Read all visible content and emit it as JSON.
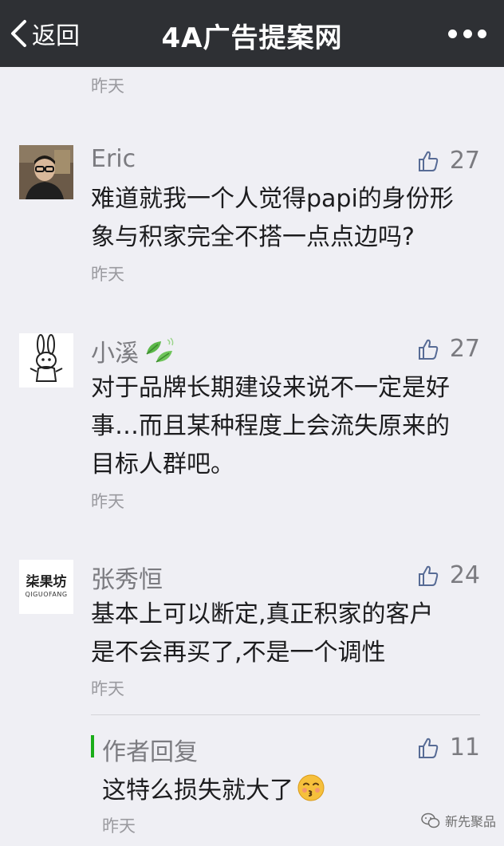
{
  "navbar": {
    "back_label": "返回",
    "title": "4A广告提案网"
  },
  "top_timestamp": "昨天",
  "comments": [
    {
      "name": "Eric",
      "likes": "27",
      "text_line1": "难道就我一个人觉得papi的身份形",
      "text_line2": "象与积家完全不搭一点点边吗?",
      "time": "昨天"
    },
    {
      "name": "小溪",
      "likes": "27",
      "text_line1": "对于品牌长期建设来说不一定是好",
      "text_line2": "事…而且某种程度上会流失原来的",
      "text_line3": "目标人群吧。",
      "time": "昨天"
    },
    {
      "name": "张秀恒",
      "likes": "24",
      "avatar_logo": "柒果坊",
      "avatar_logo_sub": "QIGUOFANG",
      "text_line1": "基本上可以断定,真正积家的客户",
      "text_line2": "是不会再买了,不是一个调性",
      "time": "昨天"
    }
  ],
  "author_reply": {
    "label": "作者回复",
    "likes": "11",
    "text": "这特么损失就大了",
    "time": "昨天"
  },
  "watermark": "新先聚品",
  "colors": {
    "navbar_bg": "#2e3034",
    "page_bg": "#efeff4",
    "like_icon": "#576b95",
    "reply_bar": "#1aad19"
  }
}
